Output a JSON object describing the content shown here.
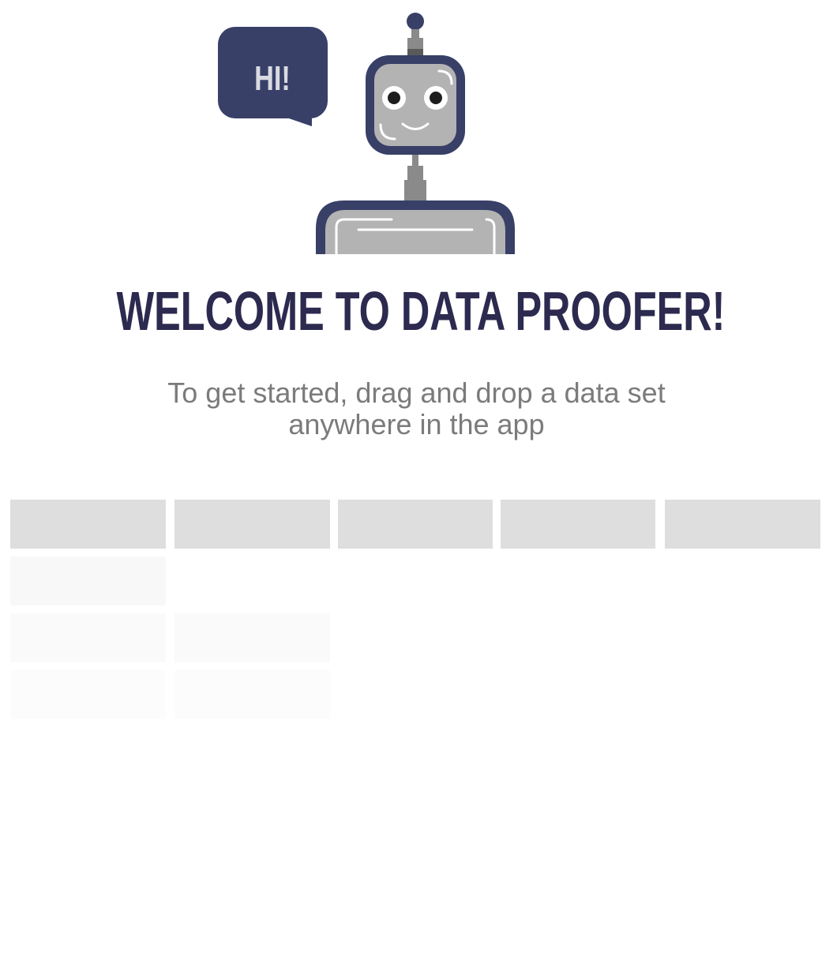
{
  "bubble_text": "HI!",
  "title": "WELCOME TO DATA PROOFER!",
  "instructions": "To get started, drag and drop a data set anywhere in the app",
  "colors": {
    "navy": "#384068",
    "title": "#2c2a4f",
    "robot_gray": "#b3b3b3",
    "text_gray": "#7b7b7b",
    "placeholder_header": "#dedede"
  },
  "icons": [
    "robot-icon",
    "speech-bubble-icon"
  ],
  "placeholder_table": {
    "columns": 5,
    "header_cells": 5,
    "body_rows_cells": [
      1,
      2,
      2
    ]
  }
}
